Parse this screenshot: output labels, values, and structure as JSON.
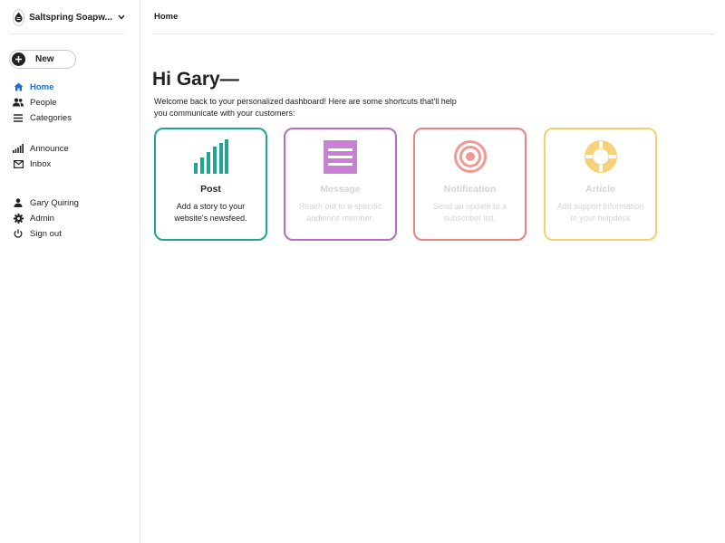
{
  "workspace": {
    "name": "Saltspring Soapw...",
    "logo_icon": "soap-logo-icon"
  },
  "sidebar": {
    "new_label": "New",
    "primary_items": [
      {
        "label": "Home",
        "icon": "home-icon",
        "active": true
      },
      {
        "label": "People",
        "icon": "people-icon"
      },
      {
        "label": "Categories",
        "icon": "list-icon"
      }
    ],
    "secondary_items": [
      {
        "label": "Announce",
        "icon": "signal-bars-icon"
      },
      {
        "label": "Inbox",
        "icon": "envelope-icon"
      }
    ],
    "account_items": [
      {
        "label": "Gary Quiring",
        "icon": "user-icon"
      },
      {
        "label": "Admin",
        "icon": "gear-icon"
      },
      {
        "label": "Sign out",
        "icon": "power-icon"
      }
    ]
  },
  "header": {
    "breadcrumb": "Home"
  },
  "main": {
    "greeting": "Hi Gary—",
    "welcome": "Welcome back to your personalized dashboard! Here are some shortcuts that'll help you communicate with your customers:",
    "cards": [
      {
        "title": "Post",
        "description": "Add a story to your website's newsfeed.",
        "icon": "signal-bars-icon",
        "color": "#22a58f",
        "state": "active"
      },
      {
        "title": "Message",
        "description": "Reach out to a specific audience member.",
        "icon": "message-lines-icon",
        "color": "#b76bc7",
        "state": "faded"
      },
      {
        "title": "Notification",
        "description": "Send an update to a subscriber list.",
        "icon": "target-icon",
        "color": "#e8837f",
        "state": "faded"
      },
      {
        "title": "Article",
        "description": "Add support information to your helpdesk",
        "icon": "lifebuoy-icon",
        "color": "#f7cf6a",
        "state": "faded"
      }
    ]
  },
  "colors": {
    "accent_blue": "#1a6fd1",
    "divider": "#e6e6e6"
  }
}
